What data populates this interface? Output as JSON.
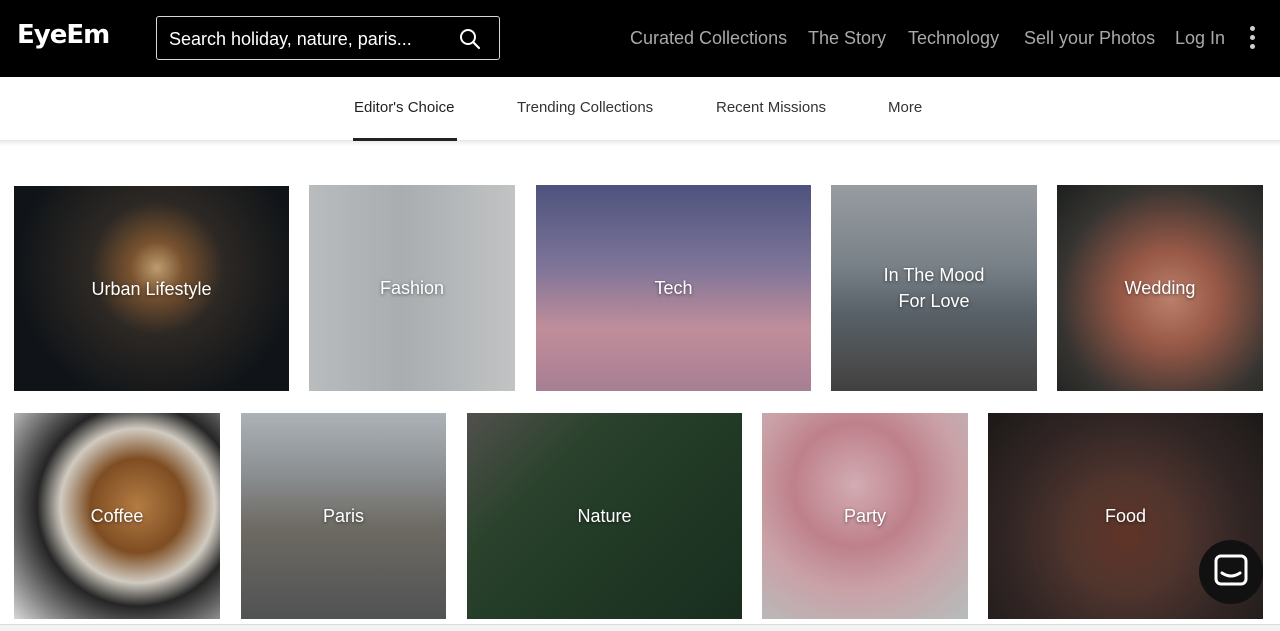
{
  "header": {
    "logo": "EyeEm",
    "search_placeholder": "Search holiday, nature, paris...",
    "nav": [
      "Curated Collections",
      "The Story",
      "Technology",
      "Sell your Photos",
      "Log In"
    ]
  },
  "subnav": {
    "tabs": [
      "Editor's Choice",
      "Trending Collections",
      "Recent Missions",
      "More"
    ],
    "active": "Editor's Choice"
  },
  "tiles": [
    {
      "label": "Urban Lifestyle"
    },
    {
      "label": "Fashion"
    },
    {
      "label": "Tech"
    },
    {
      "label": "In The Mood For Love"
    },
    {
      "label": "Wedding"
    },
    {
      "label": "Coffee"
    },
    {
      "label": "Paris"
    },
    {
      "label": "Nature"
    },
    {
      "label": "Party"
    },
    {
      "label": "Food"
    }
  ],
  "icons": {
    "search": "search-icon",
    "more": "more-vertical-icon",
    "chat": "chat-icon"
  },
  "colors": {
    "header_bg": "#000000",
    "nav_text": "#a9a9a9",
    "tab_active": "#222222"
  }
}
